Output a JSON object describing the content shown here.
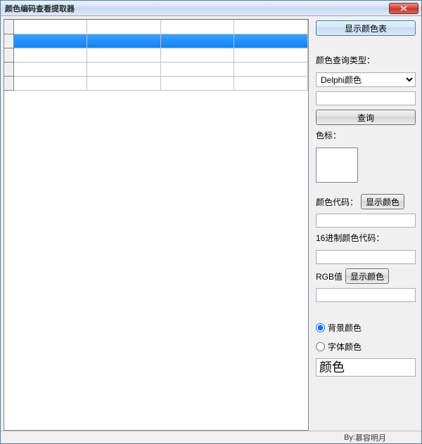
{
  "window": {
    "title": "颜色编码查看提取器"
  },
  "grid": {
    "columns": 4,
    "rows": 5,
    "selected_row_index": 1
  },
  "sidebar": {
    "show_color_table_btn": "显示颜色表",
    "query_type_label": "颜色查询类型：",
    "query_type_options": [
      "Delphi颜色"
    ],
    "query_type_selected": "Delphi颜色",
    "query_value": "",
    "query_btn": "查询",
    "swatch_label": "色标：",
    "color_code_label": "颜色代码：",
    "show_color_btn_1": "显示颜色",
    "color_code_value": "",
    "hex_code_label": "16进制颜色代码：",
    "hex_code_value": "",
    "rgb_label": "RGB值",
    "show_color_btn_2": "显示颜色",
    "rgb_value": "",
    "radio_bg_label": "背景颜色",
    "radio_font_label": "字体颜色",
    "radio_selected": "bg",
    "preview_text": "颜色"
  },
  "statusbar": {
    "author_prefix": "By:",
    "author": "慕容明月"
  }
}
